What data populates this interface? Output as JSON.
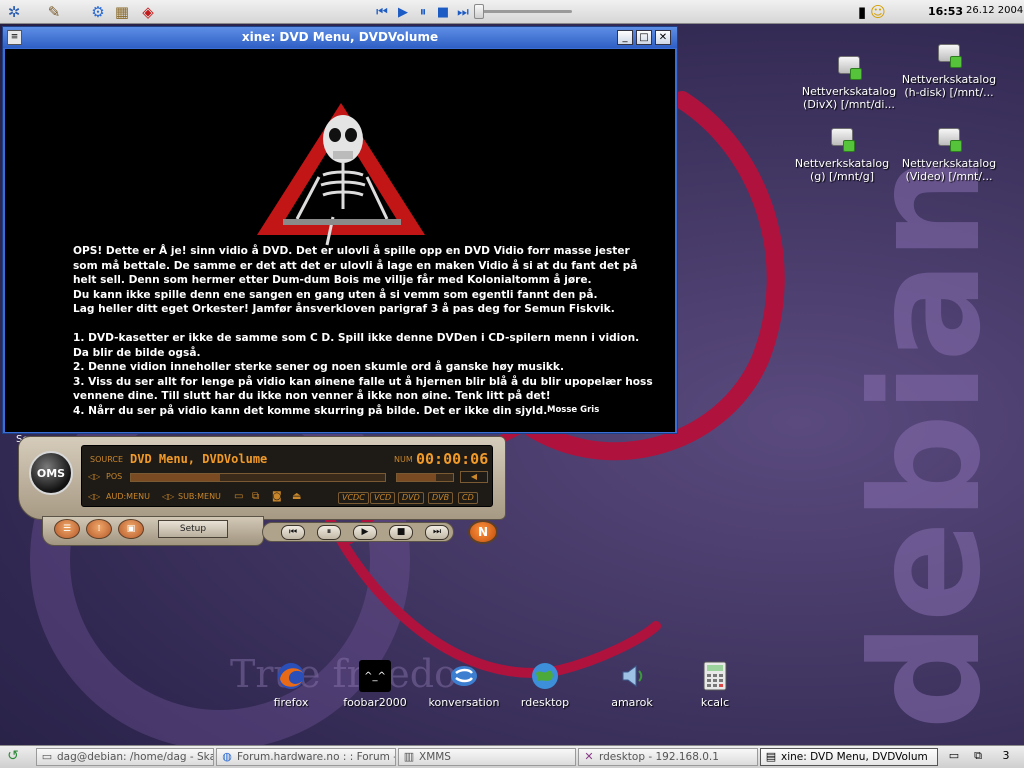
{
  "top_panel": {
    "clock": "16:53",
    "date": "26.12 2004",
    "media_buttons": [
      "previous-icon",
      "play-icon",
      "pause-icon",
      "stop-icon",
      "next-icon"
    ],
    "launcher_icons": [
      "kde-menu-icon",
      "settings-icon",
      "network-icon",
      "file-manager-icon",
      "dictionary-icon"
    ],
    "tray_icons": [
      "usb-device-icon",
      "chat-smiley-icon"
    ]
  },
  "xine_window": {
    "title": "xine: DVD Menu, DVDVolume",
    "text": "OPS! Dette er Å je! sinn vidio å DVD. Det er ulovli å spille opp en  DVD Vidio forr masse jester\nsom må bettale. De samme er det att det er ulovli å lage en maken Vidio å si at du fant det på\nhelt sell. Denn som hermer etter Dum-dum Bois me villje får med Kolonialtomm å jøre.\nDu kann ikke spille denn ene sangen en gang uten å si vemm som egentli fannt den på.\nLag heller ditt eget Orkester! Jamfør ånsverkloven parigraf 3 å pas deg  for Semun Fiskvik.\n\n1. DVD-kasetter er ikke de samme som C D. Spill ikke denne DVDen i CD-spilern menn i vidion.\nDa blir de bilde også.\n2. Denne vidion inneholler sterke sener og noen skumle ord å ganske høy musikk.\n3. Viss du ser allt for lenge på vidio kan øinene falle ut å hjernen blir blå å du blir upopelær hoss\nvennene dine. Till slutt har du ikke non venner å ikke non øine. Tenk litt på det!\n4. Nårr du ser på vidio kann det komme skurring på bilde. Det er ikke din sjyld.",
    "signature": "Mosse Gris"
  },
  "xmms": {
    "logo": "OMS",
    "source_label": "SOURCE",
    "source_value": "DVD Menu, DVDVolume",
    "num_label": "NUM",
    "time": "00:00:06",
    "pos_label": "POS",
    "aud_label": "AUD:MENU",
    "sub_label": "SUB:MENU",
    "position_fraction": 0.35,
    "volume_fraction": 0.7,
    "disc_buttons": [
      "VCDC",
      "VCD",
      "DVD",
      "DVB",
      "CD"
    ],
    "setup_label": "Setup",
    "n_button": "N"
  },
  "desktop_icons": [
    {
      "label": "Nettverkskatalog\n(DivX) [/mnt/di..."
    },
    {
      "label": "Nettverkskatalog\n(h-disk) [/mnt/..."
    },
    {
      "label": "Nettverkskatalog\n(g) [/mnt/g]"
    },
    {
      "label": "Nettverkskatalog\n(Video) [/mnt/..."
    }
  ],
  "launchers": [
    {
      "label": "firefox",
      "icon": "firefox-icon"
    },
    {
      "label": "foobar2000",
      "icon": "foobar-icon"
    },
    {
      "label": "konversation",
      "icon": "konversation-icon"
    },
    {
      "label": "rdesktop",
      "icon": "rdesktop-icon"
    },
    {
      "label": "amarok",
      "icon": "amarok-icon"
    },
    {
      "label": "kcalc",
      "icon": "kcalc-icon"
    }
  ],
  "desktop_fragment": "Se",
  "wallpaper": {
    "debian": "debian",
    "slogan": "True freedo"
  },
  "taskbar": {
    "tasks": [
      {
        "label": "dag@debian: /home/dag - Skal",
        "icon": "terminal-icon"
      },
      {
        "label": "Forum.hardware.no : : Forum -",
        "icon": "browser-icon"
      },
      {
        "label": "XMMS",
        "icon": "xmms-icon"
      },
      {
        "label": "rdesktop - 192.168.0.1",
        "icon": "x-icon"
      },
      {
        "label": "xine: DVD Menu, DVDVolum",
        "icon": "xine-icon"
      }
    ],
    "desktop_number": "3"
  },
  "colors": {
    "accent_titlebar": "#3a6ed4",
    "swirl": "#b0123e",
    "lcd_text": "#f09a2a"
  }
}
